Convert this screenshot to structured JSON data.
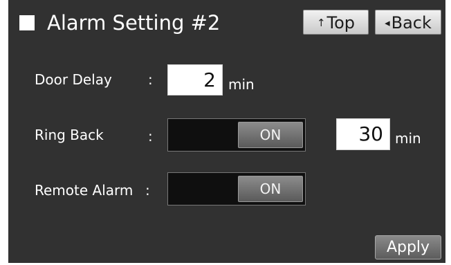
{
  "header": {
    "title": "Alarm Setting #2",
    "top_label": "Top",
    "top_arrow": "↑",
    "back_label": "Back",
    "back_arrow": "◂"
  },
  "settings": {
    "door_delay": {
      "label": "Door Delay",
      "colon": ":",
      "value": "2",
      "unit": "min"
    },
    "ring_back": {
      "label": "Ring Back",
      "colon": ":",
      "toggle_state": "ON",
      "value": "30",
      "unit": "min"
    },
    "remote_alarm": {
      "label": "Remote Alarm",
      "colon": ":",
      "toggle_state": "ON"
    }
  },
  "footer": {
    "apply_label": "Apply"
  },
  "icons": {
    "title_icon": "square-checkbox-icon",
    "top_icon": "arrow-up-icon",
    "back_icon": "triangle-left-icon"
  },
  "colors": {
    "background": "#313131",
    "value_box": "#ffffff",
    "toggle_track": "#0f0f0f",
    "toggle_knob": "#707070",
    "header_button": "#dcdcdc"
  }
}
